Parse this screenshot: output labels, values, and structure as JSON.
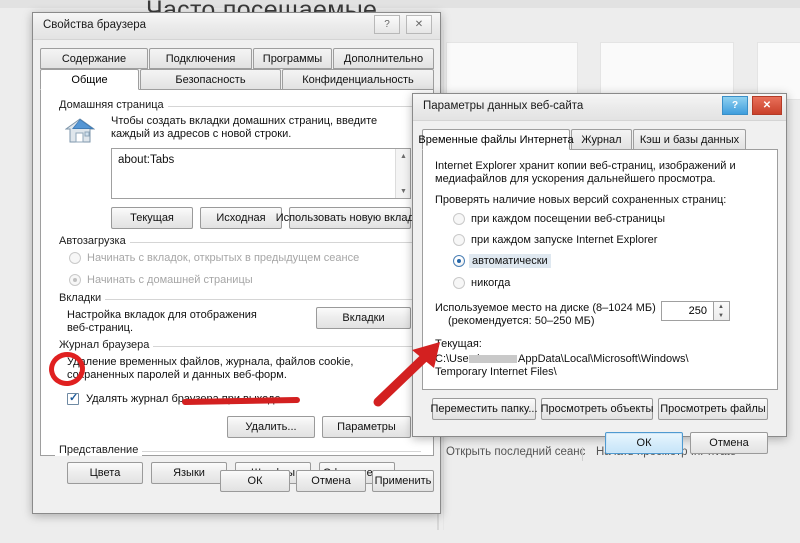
{
  "background": {
    "title": "Часто посещаемые",
    "link_reopen": "Открыть последний сеанс",
    "link_inprivate": "Начать просмотр InPrivate"
  },
  "internet_options": {
    "title": "Свойства браузера",
    "titlebar": {
      "help": "?",
      "close": "✕"
    },
    "tabs_row1": [
      "Содержание",
      "Подключения",
      "Программы",
      "Дополнительно"
    ],
    "tabs_row2": [
      "Общие",
      "Безопасность",
      "Конфиденциальность"
    ],
    "active_tab": "Общие",
    "home": {
      "group": "Домашняя страница",
      "description": "Чтобы создать вкладки домашних страниц, введите каждый из адресов с новой строки.",
      "value": "about:Tabs",
      "buttons": [
        "Текущая",
        "Исходная",
        "Использовать новую вкладку"
      ]
    },
    "startup": {
      "group": "Автозагрузка",
      "options": [
        {
          "label": "Начинать с вкладок, открытых в предыдущем сеансе",
          "selected": false
        },
        {
          "label": "Начинать с домашней страницы",
          "selected": true
        }
      ]
    },
    "tabs_section": {
      "group": "Вкладки",
      "description": "Настройка вкладок для отображения веб-страниц.",
      "button": "Вкладки"
    },
    "history": {
      "group": "Журнал браузера",
      "description": "Удаление временных файлов, журнала, файлов cookie, сохраненных паролей и данных веб-форм.",
      "checkbox_label": "Удалять журнал браузера при выходе",
      "checkbox_checked": true,
      "buttons": [
        "Удалить...",
        "Параметры"
      ]
    },
    "appearance": {
      "group": "Представление",
      "buttons": [
        "Цвета",
        "Языки",
        "Шрифты",
        "Оформление"
      ]
    },
    "footer_buttons": [
      "ОК",
      "Отмена",
      "Применить"
    ]
  },
  "website_data": {
    "title": "Параметры данных веб-сайта",
    "titlebar": {
      "help": "?",
      "close": "✕"
    },
    "tabs": [
      "Временные файлы Интернета",
      "Журнал",
      "Кэш и базы данных"
    ],
    "active_tab": "Временные файлы Интернета",
    "description": "Internet Explorer хранит копии веб-страниц, изображений и медиафайлов для ускорения дальнейшего просмотра.",
    "check_label": "Проверять наличие новых версий сохраненных страниц:",
    "options": [
      {
        "label": "при каждом посещении веб-страницы",
        "selected": false
      },
      {
        "label": "при каждом запуске Internet Explorer",
        "selected": false
      },
      {
        "label": "автоматически",
        "selected": true
      },
      {
        "label": "никогда",
        "selected": false
      }
    ],
    "disk_label_line1": "Используемое место на диске (8–1024 МБ)",
    "disk_label_line2": "(рекомендуется: 50–250 МБ)",
    "disk_value": "250",
    "current_label": "Текущая:",
    "path_line1_prefix": "C:\\Users\\",
    "path_line1_suffix": "AppData\\Local\\Microsoft\\Windows\\",
    "path_line2": "Temporary Internet Files\\",
    "buttons": [
      "Переместить папку...",
      "Просмотреть объекты",
      "Просмотреть файлы"
    ],
    "footer_buttons": [
      "ОК",
      "Отмена"
    ]
  },
  "annotations": {
    "accent_color": "#d32020",
    "ring_target": "checkbox-delete-history-on-exit",
    "arrow_direction": "up-right",
    "underline_target": "history-buttons"
  }
}
